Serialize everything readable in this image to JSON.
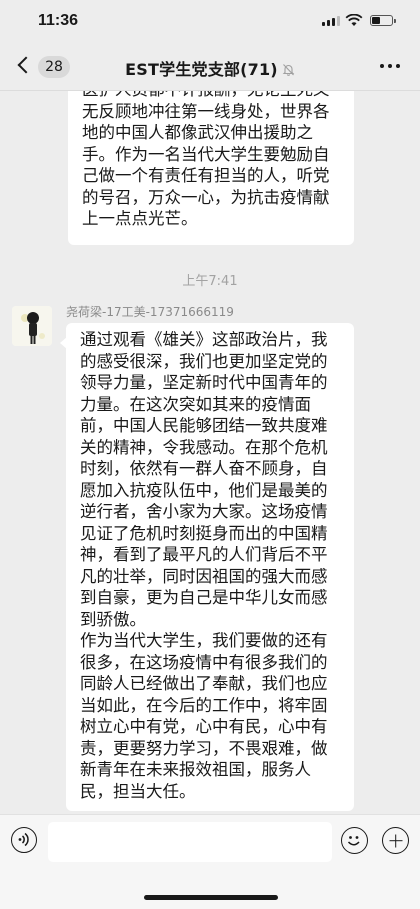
{
  "status_bar": {
    "time": "11:36"
  },
  "nav": {
    "unread_count": "28",
    "title": "EST学生党支部(71)"
  },
  "messages": [
    {
      "id": "m1",
      "text": "医护人员都不计报酬，无论生死义无反顾地冲往第一线身处，世界各地的中国人都像武汉伸出援助之手。作为一名当代大学生要勉励自己做一个有责任有担当的人，听党的号召，万众一心，为抗击疫情献上一点点光芒。"
    },
    {
      "id": "m2",
      "timestamp": "上午7:41",
      "sender": "尧荷梁-17工美-17371666119",
      "paragraphs": [
        "通过观看《雄关》这部政治片，我的感受很深，我们也更加坚定党的领导力量，坚定新时代中国青年的力量。在这次突如其来的疫情面前，中国人民能够团结一致共度难关的精神，令我感动。在那个危机时刻，依然有一群人奋不顾身，自愿加入抗疫队伍中，他们是最美的逆行者，舍小家为大家。这场疫情见证了危机时刻挺身而出的中国精神，看到了最平凡的人们背后不平凡的壮举，同时因祖国的强大而感到自豪，更为自己是中华儿女而感到骄傲。",
        "作为当代大学生，我们要做的还有很多，在这场疫情中有很多我们的同龄人已经做出了奉献，我们也应当如此，在今后的工作中，将牢固树立心中有党，心中有民，心中有责，更要努力学习，不畏艰难，做新青年在未来报效祖国，服务人民，担当大任。"
      ]
    }
  ],
  "input": {
    "placeholder": "",
    "value": ""
  },
  "icons": {
    "back": "chevron-left-icon",
    "mute": "bell-slash-icon",
    "more": "more-dots-icon",
    "voice": "voice-icon",
    "emoji": "emoji-icon",
    "plus": "plus-icon"
  },
  "colors": {
    "background": "#ededed",
    "bubble": "#ffffff",
    "text": "#191919",
    "timestamp": "#a3a3a3",
    "sender": "#8a8a8a"
  }
}
